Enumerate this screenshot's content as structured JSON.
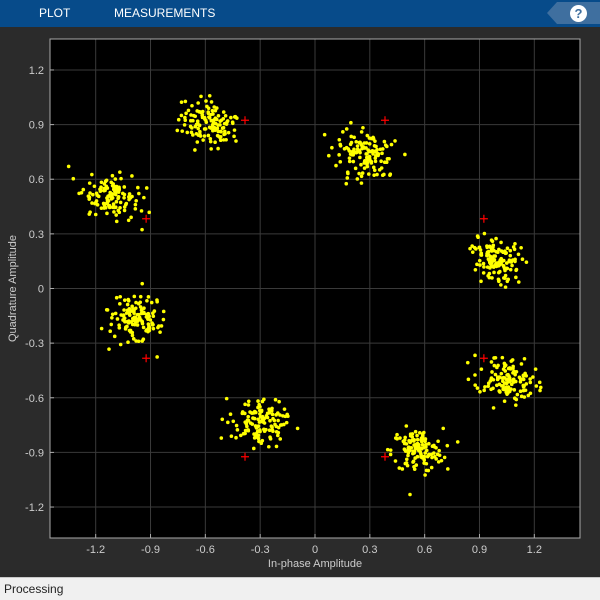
{
  "toolbar": {
    "tabs": [
      {
        "label": "PLOT"
      },
      {
        "label": "MEASUREMENTS"
      }
    ],
    "help_label": "?"
  },
  "status": {
    "text": "Processing"
  },
  "colors": {
    "toolbar_bg": "#074b8a",
    "figure_bg": "#2b2b2b",
    "axes_bg": "#000000",
    "received_points": "#ffff00",
    "reference_points": "#ff0000",
    "grid": "#3a3a3a",
    "tick_text": "#cccccc"
  },
  "chart_data": {
    "type": "scatter",
    "title": "",
    "xlabel": "In-phase Amplitude",
    "ylabel": "Quadrature Amplitude",
    "xlim": [
      -1.45,
      1.45
    ],
    "ylim": [
      -1.37,
      1.37
    ],
    "x_ticks": [
      -1.2,
      -0.9,
      -0.6,
      -0.3,
      0,
      0.3,
      0.6,
      0.9,
      1.2
    ],
    "x_tick_labels": [
      "-1.2",
      "-0.9",
      "-0.6",
      "-0.3",
      "0",
      "0.3",
      "0.6",
      "0.9",
      "1.2"
    ],
    "y_ticks": [
      1.2,
      0.9,
      0.6,
      0.3,
      0,
      -0.3,
      -0.6,
      -0.9,
      -1.2
    ],
    "y_tick_labels": [
      "1.2",
      "0.9",
      "0.6",
      "0.3",
      "0",
      "-0.3",
      "-0.6",
      "-0.9",
      "-1.2"
    ],
    "grid": true,
    "legend": "none",
    "series": [
      {
        "marker": "+",
        "color": "#ff0000",
        "points": [
          [
            -0.383,
            0.924
          ],
          [
            0.383,
            0.924
          ],
          [
            0.924,
            0.383
          ],
          [
            0.924,
            -0.383
          ],
          [
            0.383,
            -0.924
          ],
          [
            -0.383,
            -0.924
          ],
          [
            -0.924,
            -0.383
          ],
          [
            -0.924,
            0.383
          ]
        ]
      },
      {
        "marker": "dot",
        "color": "#ffff00",
        "clusters": [
          {
            "center": [
              -0.58,
              0.9
            ],
            "spread": [
              0.08,
              0.06
            ],
            "count": 130,
            "tilt": -0.35
          },
          {
            "center": [
              -1.11,
              0.51
            ],
            "spread": [
              0.08,
              0.06
            ],
            "count": 130,
            "tilt": -0.35
          },
          {
            "center": [
              -0.98,
              -0.17
            ],
            "spread": [
              0.08,
              0.06
            ],
            "count": 130,
            "tilt": -0.35
          },
          {
            "center": [
              -0.29,
              -0.74
            ],
            "spread": [
              0.08,
              0.06
            ],
            "count": 130,
            "tilt": -0.35
          },
          {
            "center": [
              0.56,
              -0.89
            ],
            "spread": [
              0.07,
              0.06
            ],
            "count": 130,
            "tilt": 0.0
          },
          {
            "center": [
              1.05,
              -0.5
            ],
            "spread": [
              0.08,
              0.06
            ],
            "count": 130,
            "tilt": -0.35
          },
          {
            "center": [
              0.99,
              0.15
            ],
            "spread": [
              0.07,
              0.06
            ],
            "count": 130,
            "tilt": -0.4
          },
          {
            "center": [
              0.27,
              0.74
            ],
            "spread": [
              0.08,
              0.06
            ],
            "count": 130,
            "tilt": -0.35
          }
        ]
      }
    ]
  }
}
